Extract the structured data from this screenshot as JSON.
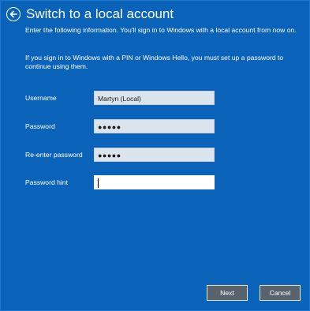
{
  "header": {
    "title": "Switch to a local account",
    "back_icon": "back-arrow-circle-icon"
  },
  "intro": {
    "line1": "Enter the following information. You'll sign in to Windows with a local account from now on.",
    "line2": "If you sign in to Windows with a PIN or Windows Hello, you must set up a password to continue using them."
  },
  "form": {
    "username_label": "Username",
    "username_value": "Martyn (Local)",
    "password_label": "Password",
    "password_value": "●●●●●",
    "reenter_label": "Re-enter password",
    "reenter_value": "●●●●●",
    "hint_label": "Password hint",
    "hint_value": ""
  },
  "buttons": {
    "next": "Next",
    "cancel": "Cancel"
  },
  "colors": {
    "background": "#0a63b9",
    "field_filled": "#dbe3ec",
    "button": "#58636d"
  }
}
